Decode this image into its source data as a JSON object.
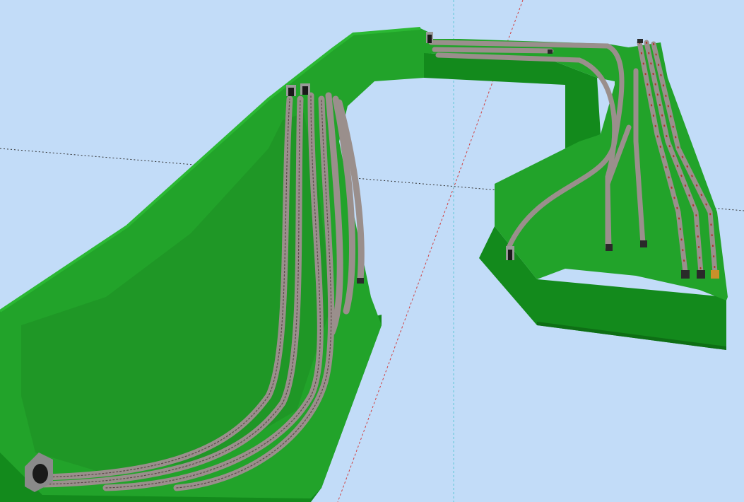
{
  "app": {
    "view": "3d-layout-viewport",
    "description_visible_text": ""
  },
  "colors": {
    "background": "#c2dcf8",
    "terrain_top": "#22a32a",
    "terrain_top_dark": "#1a8a22",
    "terrain_side": "#138a1c",
    "terrain_edge": "#0e6f15",
    "track_ballast": "#9a8f8c",
    "track_rail": "#5a4a48",
    "tie_red": "#b23028",
    "axis_red": "#d04040",
    "axis_cyan": "#60c8d8",
    "axis_black": "#303030",
    "tunnel_portal": "#4a4a4a"
  },
  "icons": {
    "tunnel_portal": "tunnel-portal-icon",
    "buffer_stop": "buffer-stop-icon"
  }
}
